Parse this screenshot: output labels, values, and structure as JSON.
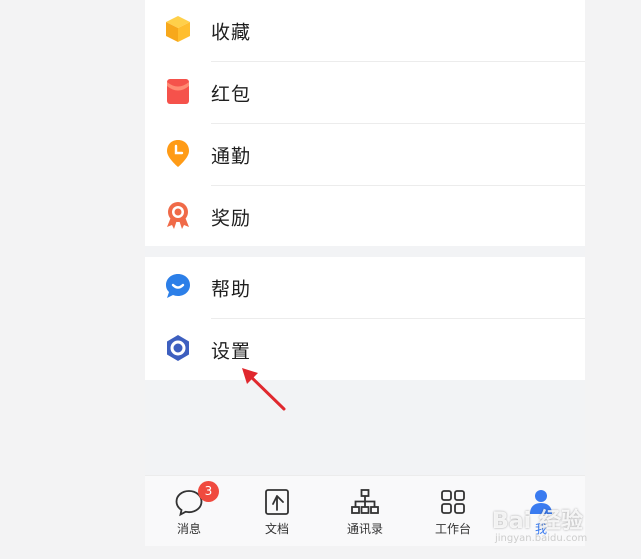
{
  "menu_group1": [
    {
      "label": "收藏",
      "icon": "favorites-box-icon"
    },
    {
      "label": "红包",
      "icon": "red-envelope-icon"
    },
    {
      "label": "通勤",
      "icon": "commute-clock-pin-icon"
    },
    {
      "label": "奖励",
      "icon": "reward-medal-icon"
    }
  ],
  "menu_group2": [
    {
      "label": "帮助",
      "icon": "help-chat-icon"
    },
    {
      "label": "设置",
      "icon": "settings-hexagon-icon"
    }
  ],
  "tabbar": {
    "messages": {
      "label": "消息",
      "badge": "3"
    },
    "docs": {
      "label": "文档"
    },
    "contacts": {
      "label": "通讯录"
    },
    "workbench": {
      "label": "工作台"
    },
    "me": {
      "label": "我"
    }
  },
  "watermark": {
    "text": "Bai 经验",
    "sub": "jingyan.baidu.com"
  },
  "colors": {
    "accent_blue": "#3a7bf0",
    "badge_red": "#f04a3f",
    "arrow_red": "#e0282e"
  }
}
